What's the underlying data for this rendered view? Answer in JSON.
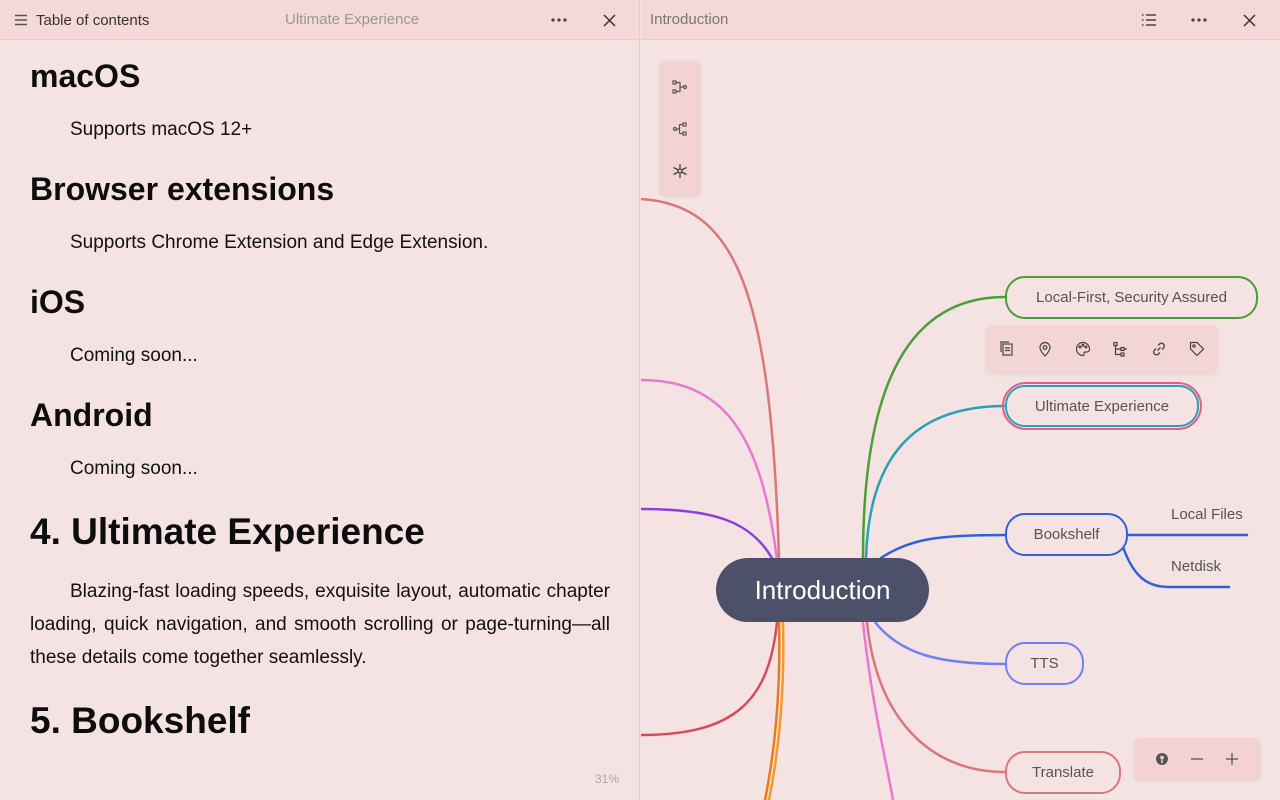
{
  "reader": {
    "toc_label": "Table of contents",
    "title": "Ultimate Experience",
    "progress": "31%",
    "content": [
      {
        "type": "h2",
        "text": "macOS"
      },
      {
        "type": "p",
        "text": "Supports macOS 12+"
      },
      {
        "type": "h2",
        "text": "Browser extensions"
      },
      {
        "type": "p",
        "text": "Supports Chrome Extension and Edge Extension."
      },
      {
        "type": "h2",
        "text": "iOS"
      },
      {
        "type": "p",
        "text": "Coming soon..."
      },
      {
        "type": "h2",
        "text": "Android"
      },
      {
        "type": "p",
        "text": "Coming soon..."
      },
      {
        "type": "h1",
        "text": "4. Ultimate Experience"
      },
      {
        "type": "p",
        "text": "Blazing-fast loading speeds, exquisite layout, automatic chapter loading, quick navigation, and smooth scrolling or page-turning—all these details come together seamlessly."
      },
      {
        "type": "h1",
        "text": "5. Bookshelf"
      }
    ]
  },
  "mindmap": {
    "title": "Introduction",
    "root": "Introduction",
    "nodes": {
      "local_first": "Local-First, Security Assured",
      "ultimate": "Ultimate Experience",
      "bookshelf": "Bookshelf",
      "local_files": "Local Files",
      "netdisk": "Netdisk",
      "tts": "TTS",
      "translate": "Translate"
    },
    "colors": {
      "root_bg": "#4c5068",
      "local_first": "#4a9e36",
      "ultimate": "#2aa1b6",
      "selection": "#e0608a",
      "bookshelf": "#2f62d9",
      "tts": "#7080f0",
      "translate": "#d87878",
      "branch_pink": "#e878d0",
      "branch_purple": "#8a3ee0",
      "branch_red": "#d84a5a",
      "branch_orange": "#ea7a1a"
    },
    "layout_buttons": [
      "logical-structure-icon",
      "mind-map-icon",
      "radial-icon"
    ],
    "node_toolbar": [
      "copy-icon",
      "location-icon",
      "palette-icon",
      "structure-icon",
      "link-icon",
      "tag-icon"
    ],
    "zoom_buttons": [
      "locate-icon",
      "zoom-out-icon",
      "zoom-in-icon"
    ]
  }
}
